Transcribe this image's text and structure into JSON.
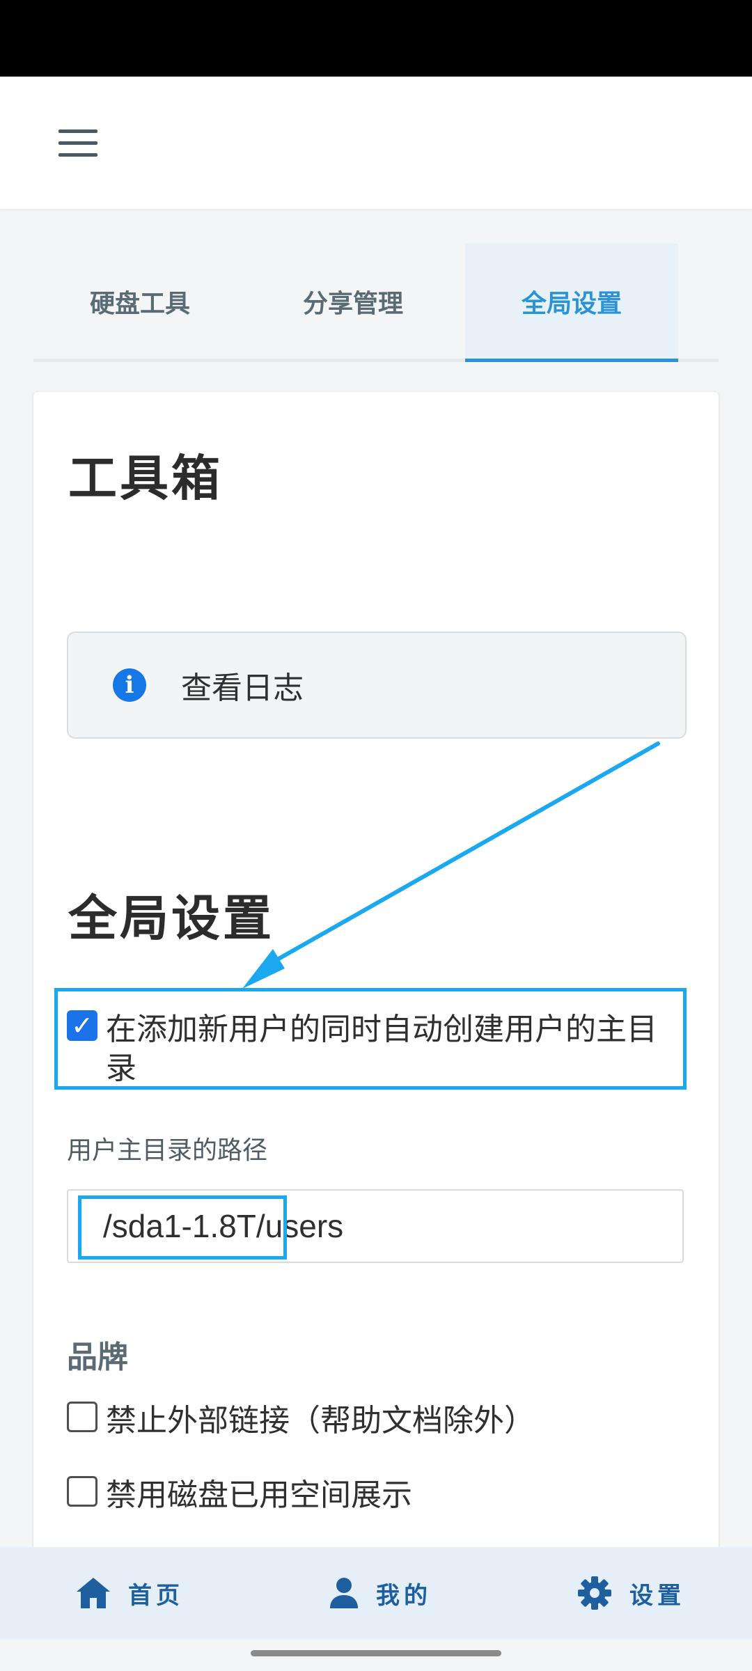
{
  "tabs": [
    {
      "label": "硬盘工具"
    },
    {
      "label": "分享管理"
    },
    {
      "label": "全局设置"
    }
  ],
  "toolbox": {
    "title": "工具箱",
    "log_button": "查看日志"
  },
  "global_settings": {
    "title": "全局设置",
    "auto_create_home": {
      "label": "在添加新用户的同时自动创建用户的主目录",
      "checked": true
    },
    "home_path_label": "用户主目录的路径",
    "home_path_value": "/sda1-1.8T/users",
    "brand_label": "品牌",
    "disable_external_links": {
      "label": "禁止外部链接（帮助文档除外）",
      "checked": false
    },
    "disable_disk_usage": {
      "label": "禁用磁盘已用空间展示",
      "checked": false
    }
  },
  "bottom_nav": [
    {
      "label": "首页",
      "icon": "home-icon"
    },
    {
      "label": "我的",
      "icon": "user-icon"
    },
    {
      "label": "设置",
      "icon": "gear-icon"
    }
  ],
  "colors": {
    "accent": "#2a93d5",
    "annotation": "#1aa8f0",
    "checkbox": "#1a73e8",
    "nav_text": "#1e5fa0"
  }
}
